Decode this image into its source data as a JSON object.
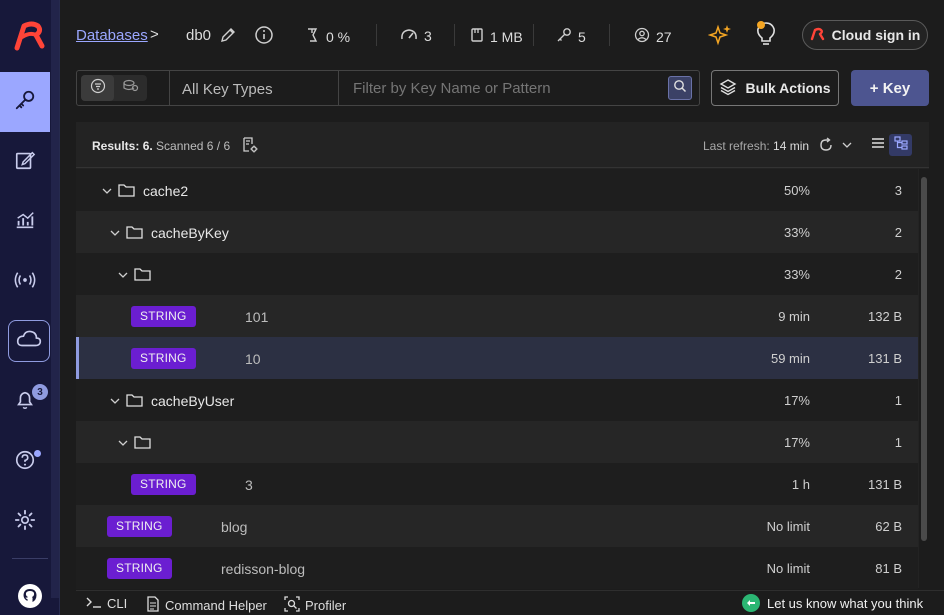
{
  "breadcrumb": {
    "databases_link": "Databases",
    "separator": ">"
  },
  "database": {
    "name": "db0"
  },
  "stats": {
    "cpu": "0 %",
    "ops": "3",
    "memory": "1 MB",
    "keys": "5",
    "clients": "27"
  },
  "header": {
    "cloud_signin_label": "Cloud sign in"
  },
  "filter": {
    "key_type_label": "All Key Types",
    "search_placeholder": "Filter by Key Name or Pattern"
  },
  "actions": {
    "bulk_actions_label": "Bulk Actions",
    "add_key_label": "+ Key"
  },
  "results": {
    "label": "Results:",
    "count": "6.",
    "scanned_label": "Scanned",
    "scanned_value": "6 / 6",
    "last_refresh_label": "Last refresh:",
    "last_refresh_value": "14 min"
  },
  "rows": [
    {
      "type": "folder",
      "name": "cache2",
      "percent": "50%",
      "count": "3"
    },
    {
      "type": "folder",
      "name": "cacheByKey",
      "percent": "33%",
      "count": "2"
    },
    {
      "type": "folder",
      "name": "",
      "percent": "33%",
      "count": "2"
    },
    {
      "type": "key",
      "badge": "STRING",
      "name": "101",
      "ttl": "9 min",
      "size": "132 B"
    },
    {
      "type": "key",
      "badge": "STRING",
      "name": "10",
      "ttl": "59 min",
      "size": "131 B"
    },
    {
      "type": "folder",
      "name": "cacheByUser",
      "percent": "17%",
      "count": "1"
    },
    {
      "type": "folder",
      "name": "",
      "percent": "17%",
      "count": "1"
    },
    {
      "type": "key",
      "badge": "STRING",
      "name": "3",
      "ttl": "1 h",
      "size": "131 B"
    },
    {
      "type": "key",
      "badge": "STRING",
      "name": "blog",
      "ttl": "No limit",
      "size": "62 B"
    },
    {
      "type": "key",
      "badge": "STRING",
      "name": "redisson-blog",
      "ttl": "No limit",
      "size": "81 B"
    }
  ],
  "sidebar": {
    "notification_count": "3"
  },
  "bottombar": {
    "cli_label": "CLI",
    "command_helper_label": "Command Helper",
    "profiler_label": "Profiler",
    "feedback_label": "Let us know what you think"
  },
  "colors": {
    "accent": "#9ba7ff",
    "sidebar_bg": "#17183a",
    "string_badge": "#6b1ed1",
    "brand_red": "#ff4438",
    "primary_button": "#4d5590"
  },
  "icons": [
    "redis-logo-icon",
    "key-icon",
    "edit-icon",
    "analytics-icon",
    "pubsub-icon",
    "cloud-icon",
    "bell-icon",
    "help-icon",
    "gear-icon",
    "github-icon",
    "pencil-icon",
    "info-icon",
    "cpu-icon",
    "speedometer-icon",
    "memory-icon",
    "key-small-icon",
    "user-icon",
    "sparkles-icon",
    "lightbulb-icon",
    "filter-icon",
    "tree-icon",
    "search-icon",
    "layers-icon",
    "settings-doc-icon",
    "refresh-icon",
    "chevron-down-icon",
    "list-view-icon",
    "tree-view-icon",
    "folder-icon",
    "terminal-icon",
    "command-helper-icon",
    "profiler-icon",
    "feedback-icon"
  ]
}
